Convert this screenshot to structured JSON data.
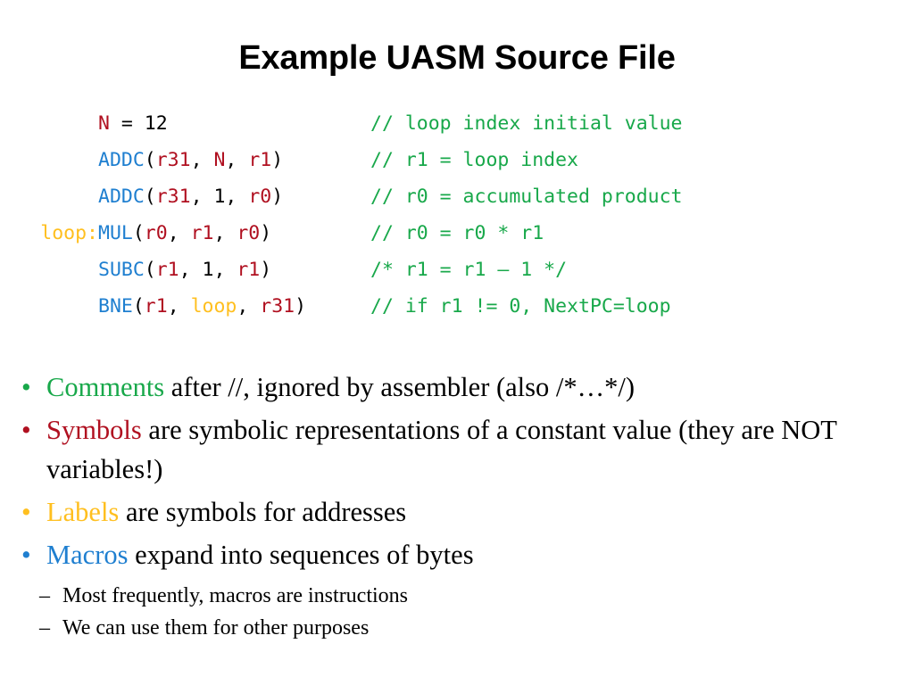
{
  "slide": {
    "title": "Example UASM Source File"
  },
  "code": {
    "lines": [
      {
        "gutter": "",
        "tokens": [
          {
            "text": "N",
            "kind": "sym"
          },
          {
            "text": " = ",
            "kind": "plain"
          },
          {
            "text": "12",
            "kind": "plain"
          }
        ],
        "comment": "// loop index initial value"
      },
      {
        "gutter": "",
        "tokens": [
          {
            "text": "ADDC",
            "kind": "macro"
          },
          {
            "text": "(",
            "kind": "plain"
          },
          {
            "text": "r31",
            "kind": "sym"
          },
          {
            "text": ", ",
            "kind": "plain"
          },
          {
            "text": "N",
            "kind": "sym"
          },
          {
            "text": ", ",
            "kind": "plain"
          },
          {
            "text": "r1",
            "kind": "sym"
          },
          {
            "text": ")",
            "kind": "plain"
          }
        ],
        "comment": "// r1 = loop index"
      },
      {
        "gutter": "",
        "tokens": [
          {
            "text": "ADDC",
            "kind": "macro"
          },
          {
            "text": "(",
            "kind": "plain"
          },
          {
            "text": "r31",
            "kind": "sym"
          },
          {
            "text": ", ",
            "kind": "plain"
          },
          {
            "text": "1",
            "kind": "plain"
          },
          {
            "text": ", ",
            "kind": "plain"
          },
          {
            "text": "r0",
            "kind": "sym"
          },
          {
            "text": ")",
            "kind": "plain"
          }
        ],
        "comment": "// r0 = accumulated product"
      },
      {
        "gutter": "loop:",
        "gutter_kind": "label",
        "tokens": [
          {
            "text": "MUL",
            "kind": "macro"
          },
          {
            "text": "(",
            "kind": "plain"
          },
          {
            "text": "r0",
            "kind": "sym"
          },
          {
            "text": ", ",
            "kind": "plain"
          },
          {
            "text": "r1",
            "kind": "sym"
          },
          {
            "text": ", ",
            "kind": "plain"
          },
          {
            "text": "r0",
            "kind": "sym"
          },
          {
            "text": ")",
            "kind": "plain"
          }
        ],
        "comment": "// r0 = r0 * r1"
      },
      {
        "gutter": "",
        "tokens": [
          {
            "text": "SUBC",
            "kind": "macro"
          },
          {
            "text": "(",
            "kind": "plain"
          },
          {
            "text": "r1",
            "kind": "sym"
          },
          {
            "text": ", ",
            "kind": "plain"
          },
          {
            "text": "1",
            "kind": "plain"
          },
          {
            "text": ", ",
            "kind": "plain"
          },
          {
            "text": "r1",
            "kind": "sym"
          },
          {
            "text": ")",
            "kind": "plain"
          }
        ],
        "comment": "/* r1 = r1 – 1 */"
      },
      {
        "gutter": "",
        "tokens": [
          {
            "text": "BNE",
            "kind": "macro"
          },
          {
            "text": "(",
            "kind": "plain"
          },
          {
            "text": "r1",
            "kind": "sym"
          },
          {
            "text": ", ",
            "kind": "plain"
          },
          {
            "text": "loop",
            "kind": "label"
          },
          {
            "text": ", ",
            "kind": "plain"
          },
          {
            "text": "r31",
            "kind": "sym"
          },
          {
            "text": ")",
            "kind": "plain"
          }
        ],
        "comment": "// if r1 != 0, NextPC=loop"
      }
    ]
  },
  "bullets": [
    {
      "bullet_glyph": "•",
      "keyword": "Comments",
      "keyword_color_key": "comments",
      "rest": " after //, ignored by assembler (also /*…*/)"
    },
    {
      "bullet_glyph": "•",
      "keyword": "Symbols",
      "keyword_color_key": "symbols",
      "rest": " are symbolic representations of a constant value (they are NOT variables!)"
    },
    {
      "bullet_glyph": "•",
      "keyword": "Labels",
      "keyword_color_key": "labels",
      "rest": " are symbols for addresses"
    },
    {
      "bullet_glyph": "•",
      "keyword": "Macros",
      "keyword_color_key": "macros",
      "rest": " expand into sequences of bytes",
      "sub_items": [
        {
          "dash_glyph": "–",
          "text": "Most frequently, macros are instructions"
        },
        {
          "dash_glyph": "–",
          "text": "We can use them for other purposes"
        }
      ]
    }
  ],
  "colors": {
    "symbol_red": "#B01020",
    "macro_blue": "#1F7FD0",
    "label_gold": "#FFBF1F",
    "comment_green": "#18A84A",
    "text_black": "#000000",
    "background": "#FFFFFF"
  }
}
